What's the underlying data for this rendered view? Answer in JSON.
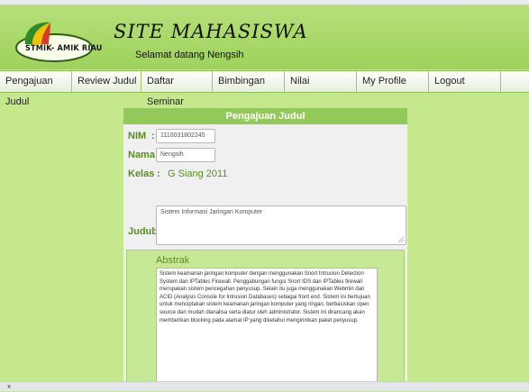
{
  "header": {
    "logo_text": "STMIK- AMIK RIAU",
    "site_title": "SITE MAHASISWA",
    "subtitle": "Selamat datang Nengsih"
  },
  "nav": {
    "items": [
      "Pengajuan Judul",
      "Review Judul",
      "Daftar Seminar",
      "Bimbingan",
      "Nilai",
      "My Profile",
      "Logout"
    ]
  },
  "panel": {
    "title": "Pengajuan Judul",
    "nim_label": "NIM",
    "nim_value": "1110031802245",
    "nama_label": "Nama",
    "nama_value": "Nengsih",
    "kelas_label": "Kelas",
    "kelas_value": "G Siang 2011",
    "judul_label": "Judul",
    "judul_value": "Sistem Informasi Jaringan Komputer",
    "colon": ":",
    "abstrak_label": "Abstrak",
    "abstrak_value": "Sistem keamanan jaringan komputer dengan menggunakan Snort Intrusion Detection System dan IPTables Firewall. Penggabungan fungsi Snort IDS dan IPTables firewall merupakan sistem pencegahan penyusup. Selain itu juga menggunakan Webmin dan ACID (Analysis Console for Intrusion Databases) sebagai front end. Sistem ini bertujuan untuk menciptakan sistem keamanan jaringan komputer yang ringan, berbasiskan open source dan mudah dianalisa serta diatur oleh administrator. Sistem ini dirancang akan memberikan blocking pada alamat IP yang diketahui mengirimkan paket penyusup."
  },
  "statusbar": {
    "text": "x"
  },
  "colors": {
    "page_bg": "#c4e88b",
    "header_green": "#9ed25c",
    "panel_header": "#93c85a",
    "label_green": "#5a8d21",
    "panel_bg": "#f0f0f0"
  }
}
